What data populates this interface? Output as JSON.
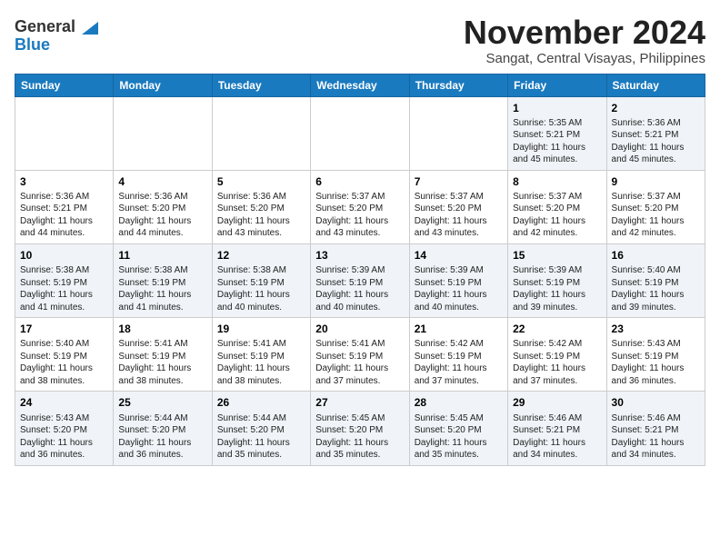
{
  "logo": {
    "line1": "General",
    "line2": "Blue"
  },
  "title": "November 2024",
  "location": "Sangat, Central Visayas, Philippines",
  "days_of_week": [
    "Sunday",
    "Monday",
    "Tuesday",
    "Wednesday",
    "Thursday",
    "Friday",
    "Saturday"
  ],
  "weeks": [
    [
      {
        "day": "",
        "info": ""
      },
      {
        "day": "",
        "info": ""
      },
      {
        "day": "",
        "info": ""
      },
      {
        "day": "",
        "info": ""
      },
      {
        "day": "",
        "info": ""
      },
      {
        "day": "1",
        "info": "Sunrise: 5:35 AM\nSunset: 5:21 PM\nDaylight: 11 hours and 45 minutes."
      },
      {
        "day": "2",
        "info": "Sunrise: 5:36 AM\nSunset: 5:21 PM\nDaylight: 11 hours and 45 minutes."
      }
    ],
    [
      {
        "day": "3",
        "info": "Sunrise: 5:36 AM\nSunset: 5:21 PM\nDaylight: 11 hours and 44 minutes."
      },
      {
        "day": "4",
        "info": "Sunrise: 5:36 AM\nSunset: 5:20 PM\nDaylight: 11 hours and 44 minutes."
      },
      {
        "day": "5",
        "info": "Sunrise: 5:36 AM\nSunset: 5:20 PM\nDaylight: 11 hours and 43 minutes."
      },
      {
        "day": "6",
        "info": "Sunrise: 5:37 AM\nSunset: 5:20 PM\nDaylight: 11 hours and 43 minutes."
      },
      {
        "day": "7",
        "info": "Sunrise: 5:37 AM\nSunset: 5:20 PM\nDaylight: 11 hours and 43 minutes."
      },
      {
        "day": "8",
        "info": "Sunrise: 5:37 AM\nSunset: 5:20 PM\nDaylight: 11 hours and 42 minutes."
      },
      {
        "day": "9",
        "info": "Sunrise: 5:37 AM\nSunset: 5:20 PM\nDaylight: 11 hours and 42 minutes."
      }
    ],
    [
      {
        "day": "10",
        "info": "Sunrise: 5:38 AM\nSunset: 5:19 PM\nDaylight: 11 hours and 41 minutes."
      },
      {
        "day": "11",
        "info": "Sunrise: 5:38 AM\nSunset: 5:19 PM\nDaylight: 11 hours and 41 minutes."
      },
      {
        "day": "12",
        "info": "Sunrise: 5:38 AM\nSunset: 5:19 PM\nDaylight: 11 hours and 40 minutes."
      },
      {
        "day": "13",
        "info": "Sunrise: 5:39 AM\nSunset: 5:19 PM\nDaylight: 11 hours and 40 minutes."
      },
      {
        "day": "14",
        "info": "Sunrise: 5:39 AM\nSunset: 5:19 PM\nDaylight: 11 hours and 40 minutes."
      },
      {
        "day": "15",
        "info": "Sunrise: 5:39 AM\nSunset: 5:19 PM\nDaylight: 11 hours and 39 minutes."
      },
      {
        "day": "16",
        "info": "Sunrise: 5:40 AM\nSunset: 5:19 PM\nDaylight: 11 hours and 39 minutes."
      }
    ],
    [
      {
        "day": "17",
        "info": "Sunrise: 5:40 AM\nSunset: 5:19 PM\nDaylight: 11 hours and 38 minutes."
      },
      {
        "day": "18",
        "info": "Sunrise: 5:41 AM\nSunset: 5:19 PM\nDaylight: 11 hours and 38 minutes."
      },
      {
        "day": "19",
        "info": "Sunrise: 5:41 AM\nSunset: 5:19 PM\nDaylight: 11 hours and 38 minutes."
      },
      {
        "day": "20",
        "info": "Sunrise: 5:41 AM\nSunset: 5:19 PM\nDaylight: 11 hours and 37 minutes."
      },
      {
        "day": "21",
        "info": "Sunrise: 5:42 AM\nSunset: 5:19 PM\nDaylight: 11 hours and 37 minutes."
      },
      {
        "day": "22",
        "info": "Sunrise: 5:42 AM\nSunset: 5:19 PM\nDaylight: 11 hours and 37 minutes."
      },
      {
        "day": "23",
        "info": "Sunrise: 5:43 AM\nSunset: 5:19 PM\nDaylight: 11 hours and 36 minutes."
      }
    ],
    [
      {
        "day": "24",
        "info": "Sunrise: 5:43 AM\nSunset: 5:20 PM\nDaylight: 11 hours and 36 minutes."
      },
      {
        "day": "25",
        "info": "Sunrise: 5:44 AM\nSunset: 5:20 PM\nDaylight: 11 hours and 36 minutes."
      },
      {
        "day": "26",
        "info": "Sunrise: 5:44 AM\nSunset: 5:20 PM\nDaylight: 11 hours and 35 minutes."
      },
      {
        "day": "27",
        "info": "Sunrise: 5:45 AM\nSunset: 5:20 PM\nDaylight: 11 hours and 35 minutes."
      },
      {
        "day": "28",
        "info": "Sunrise: 5:45 AM\nSunset: 5:20 PM\nDaylight: 11 hours and 35 minutes."
      },
      {
        "day": "29",
        "info": "Sunrise: 5:46 AM\nSunset: 5:21 PM\nDaylight: 11 hours and 34 minutes."
      },
      {
        "day": "30",
        "info": "Sunrise: 5:46 AM\nSunset: 5:21 PM\nDaylight: 11 hours and 34 minutes."
      }
    ]
  ]
}
